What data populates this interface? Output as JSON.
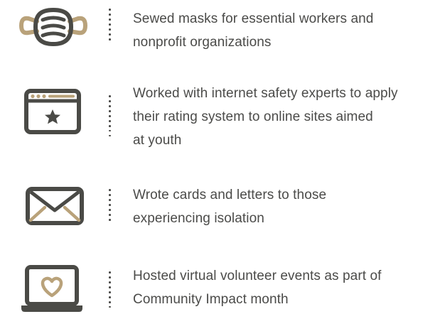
{
  "colors": {
    "icon_dark": "#4a4a46",
    "icon_accent": "#b9a27a",
    "text": "#4b4b49"
  },
  "items": [
    {
      "icon": "face-mask-icon",
      "lines": [
        "Sewed masks for essential workers and",
        "nonprofit organizations"
      ]
    },
    {
      "icon": "browser-star-icon",
      "lines": [
        "Worked with internet safety experts to apply",
        "their rating system to online sites aimed",
        "at youth"
      ]
    },
    {
      "icon": "envelope-icon",
      "lines": [
        "Wrote cards and letters to those",
        "experiencing isolation"
      ]
    },
    {
      "icon": "laptop-heart-icon",
      "lines": [
        "Hosted virtual volunteer events as part of",
        "Community Impact month"
      ]
    }
  ]
}
